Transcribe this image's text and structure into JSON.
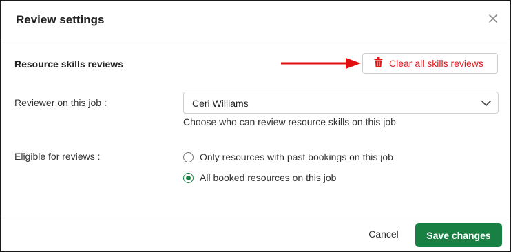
{
  "dialog": {
    "title": "Review settings",
    "close_icon": "close-icon"
  },
  "skills_reviews": {
    "label": "Resource skills reviews",
    "clear_button_label": "Clear all skills reviews",
    "clear_icon": "trash-icon",
    "accent_color": "#e01a1a"
  },
  "reviewer": {
    "label": "Reviewer on this job :",
    "selected_value": "Ceri Williams",
    "helper_text": "Choose who can review resource skills on this job"
  },
  "eligibility": {
    "label": "Eligible for reviews :",
    "options": [
      {
        "label": "Only resources with past bookings on this job",
        "checked": false
      },
      {
        "label": "All booked resources on this job",
        "checked": true
      }
    ]
  },
  "footer": {
    "cancel_label": "Cancel",
    "save_label": "Save changes",
    "save_color": "#188042"
  }
}
